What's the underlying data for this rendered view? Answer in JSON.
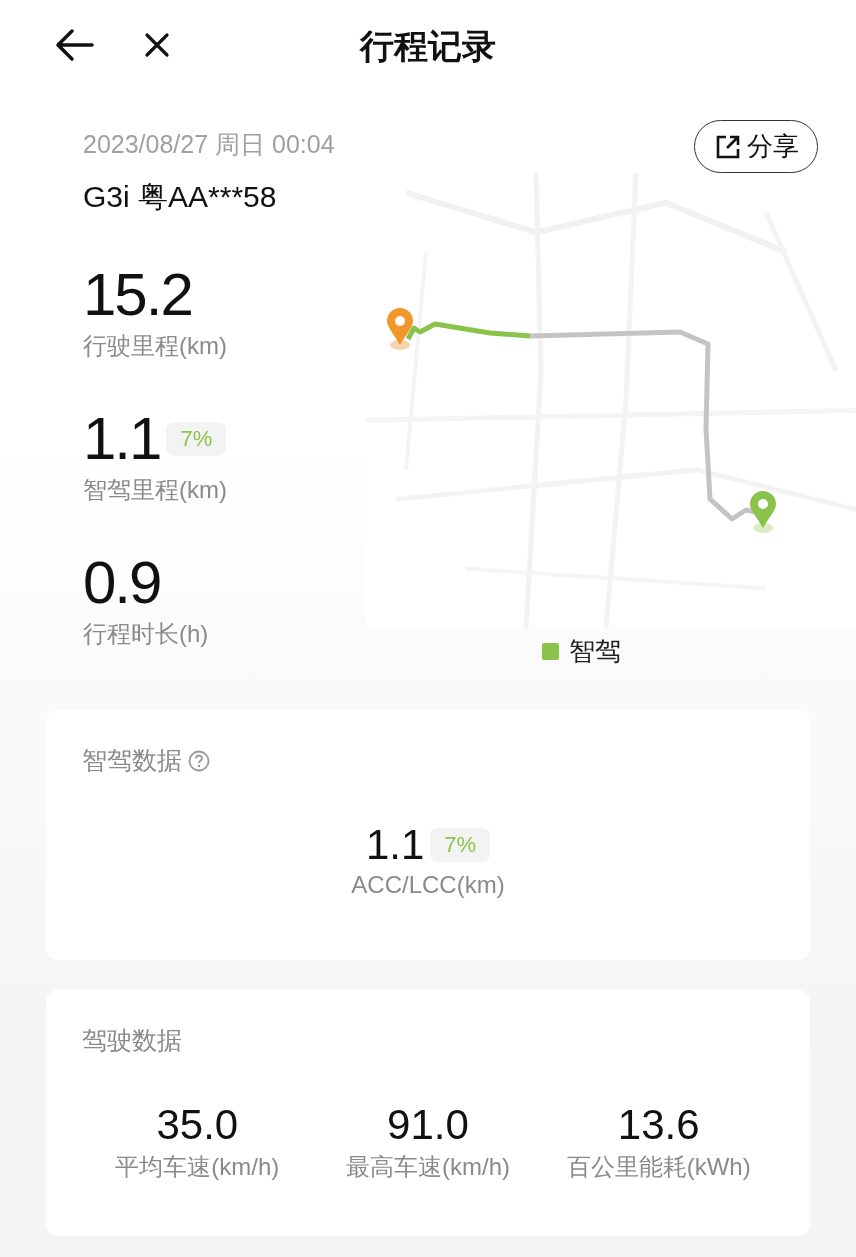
{
  "header": {
    "title": "行程记录"
  },
  "trip": {
    "datetime": "2023/08/27 周日 00:04",
    "vehicle": "G3i 粤AA***58",
    "share_label": "分享"
  },
  "stats": [
    {
      "value": "15.2",
      "label": "行驶里程(km)"
    },
    {
      "value": "1.1",
      "badge": "7%",
      "label": "智驾里程(km)"
    },
    {
      "value": "0.9",
      "label": "行程时长(h)"
    }
  ],
  "map": {
    "legend": "智驾"
  },
  "smart_driving": {
    "title": "智驾数据",
    "value": "1.1",
    "badge": "7%",
    "label": "ACC/LCC(km)"
  },
  "driving": {
    "title": "驾驶数据",
    "metrics": [
      {
        "value": "35.0",
        "label": "平均车速(km/h)"
      },
      {
        "value": "91.0",
        "label": "最高车速(km/h)"
      },
      {
        "value": "13.6",
        "label": "百公里能耗(kWh)"
      }
    ]
  }
}
